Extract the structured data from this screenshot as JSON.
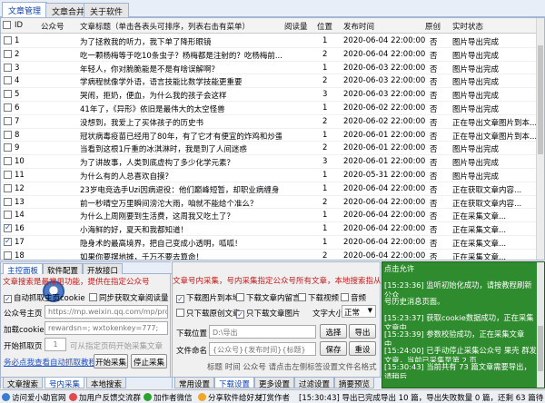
{
  "top_tabs": [
    "文章管理",
    "文章合并",
    "关于软件"
  ],
  "table": {
    "headers": [
      "ID",
      "公众号",
      "文章标题（单击各表头可排序，列表右击有菜单）",
      "阅读量",
      "位置",
      "发布时间",
      "原创",
      "实时状态"
    ],
    "rows": [
      {
        "id": "1",
        "checked": false,
        "title": "为了拯救我的听力，我下单了降形眼镜",
        "pos": "1",
        "time": "2020-06-04 22:00:00",
        "orig": "否",
        "status": "图片导出完成"
      },
      {
        "id": "2",
        "checked": false,
        "title": "吃一颗杨梅等于吃10条虫子？杨梅都是注射的？吃杨梅前...",
        "pos": "2",
        "time": "2020-06-04 22:00:00",
        "orig": "否",
        "status": "图片导出完成"
      },
      {
        "id": "3",
        "checked": false,
        "title": "年轻人，你对脆脆能是不是有啥误解啊？",
        "pos": "1",
        "time": "2020-06-03 22:00:00",
        "orig": "否",
        "status": "图片导出完成"
      },
      {
        "id": "4",
        "checked": false,
        "title": "学病程就像学外语，语言技能比数学技能更重要",
        "pos": "2",
        "time": "2020-06-03 22:00:00",
        "orig": "否",
        "status": "图片导出完成"
      },
      {
        "id": "5",
        "checked": false,
        "title": "哭闹，拒奶，便血，为什么我的孩子会这样",
        "pos": "3",
        "time": "2020-06-03 22:00:00",
        "orig": "否",
        "status": "图片导出完成"
      },
      {
        "id": "6",
        "checked": false,
        "title": "41年了，《异形》依旧是最伟大的太空怪兽",
        "pos": "1",
        "time": "2020-06-02 22:00:00",
        "orig": "否",
        "status": "图片导出完成"
      },
      {
        "id": "7",
        "checked": false,
        "title": "没想到，我爱上了买体孩子的历史书",
        "pos": "2",
        "time": "2020-06-02 22:00:00",
        "orig": "否",
        "status": "正在导出文章图片到本..."
      },
      {
        "id": "8",
        "checked": false,
        "title": "冠状病毒疫苗已经用了80年，有了它才有便宜的炸鸡和炒蛋",
        "pos": "1",
        "time": "2020-06-01 22:00:00",
        "orig": "否",
        "status": "正在导出文章图片到本..."
      },
      {
        "id": "9",
        "checked": false,
        "title": "当看到这根1斤重的冰淇淋时，我是到了人间迷惑",
        "pos": "2",
        "time": "2020-06-01 22:00:00",
        "orig": "否",
        "status": "图片导出完成"
      },
      {
        "id": "10",
        "checked": false,
        "title": "为了讲故事，人类到底虚构了多少化学元素？",
        "pos": "3",
        "time": "2020-06-01 22:00:00",
        "orig": "否",
        "status": "图片导出完成"
      },
      {
        "id": "11",
        "checked": false,
        "title": "为什么有的人总喜欢自摸？",
        "pos": "1",
        "time": "2020-05-31 22:00:00",
        "orig": "否",
        "status": "图片导出完成"
      },
      {
        "id": "12",
        "checked": false,
        "title": "23岁电竞选手Uzi因病退役：他们巅峰短暂，却职业病缠身",
        "pos": "1",
        "time": "2020-06-04 22:00:00",
        "orig": "否",
        "status": "正在获取文章内容..."
      },
      {
        "id": "13",
        "checked": false,
        "title": "前一秒晴空万里瞬间滂沱大雨，咱就不能给个准么？",
        "pos": "2",
        "time": "2020-06-04 22:00:00",
        "orig": "否",
        "status": "正在获取文章内容..."
      },
      {
        "id": "14",
        "checked": false,
        "title": "为什么上周刚要到生活费，这周我又吃土了？",
        "pos": "1",
        "time": "2020-06-04 22:00:00",
        "orig": "否",
        "status": "正在采集文章..."
      },
      {
        "id": "16",
        "checked": true,
        "title": "小海鲜的好，夏天和我都知道！",
        "pos": "1",
        "time": "2020-06-04 22:00:00",
        "orig": "否",
        "status": "正在采集文章..."
      },
      {
        "id": "17",
        "checked": true,
        "title": "隐身术的最高境界，把自己变成小透明，呱呱！",
        "pos": "1",
        "time": "2020-06-04 22:00:00",
        "orig": "否",
        "status": "正在采集文章..."
      },
      {
        "id": "18",
        "checked": false,
        "title": "如果你要摆地摊，千万不要去算命！",
        "pos": "2",
        "time": "2020-06-04 22:00:00",
        "orig": "否",
        "status": "正在采集文章..."
      },
      {
        "id": "19",
        "checked": true,
        "title": "是不是从没有人告诉过你，论文被拒了怎么办？",
        "pos": "1",
        "time": "2020-06-04 22:00:00",
        "orig": "否",
        "status": "正在采集文章..."
      }
    ]
  },
  "left": {
    "tabs": [
      "主控面板",
      "软件配置",
      "开放接口"
    ],
    "tip": "文章搜索是最常用功能，提供在指定公众号",
    "auto_label": "自动抓取主页cookie",
    "sync_label": "同步获取文章阅读量",
    "home_label": "公众号主页",
    "home_value": "https://mp.weixin.qq.com/mp/prc",
    "cookie_label": "加载cookie",
    "cookie_value": "rewardsn=; wxtokenkey=777;",
    "page_label": "开始抓取页",
    "page_value": "1",
    "page_hint": "可从指定页码开始采集文章",
    "link_text": "务必点我查看自动抓取教程",
    "start_button": "开始采集",
    "stop_button": "停止采集",
    "bottom_tabs": [
      "文章搜索",
      "号内采集",
      "本地搜索"
    ]
  },
  "marquee": "文章号内采集，号内采集指定公众号所有文章，本地搜索指从历史搜索文章中快速筛选",
  "middle": {
    "options": [
      "下载图片到本地",
      "下载文章内留言",
      "下载视频",
      "音频",
      "只下载原创文章",
      "只下载文章图片"
    ],
    "checked": [
      true,
      false,
      false,
      false,
      false,
      true
    ],
    "size_label": "文字大小",
    "size_value": "正常",
    "path_label": "下载位置",
    "path_value": "D:\\导出",
    "select_button": "选择",
    "export_button": "导出",
    "name_label": "文件命名",
    "name_value": "{公众号}{发布时间}{标题}",
    "save_button": "保存",
    "reset_button": "重设",
    "hint": "标题  时间  公众号  请点击左侧标签设置文件名格式",
    "bottom_tabs": [
      "常用设置",
      "下载设置",
      "更多设置",
      "过滤设置",
      "摘要预览"
    ]
  },
  "log": [
    "点击允许",
    "[15:23:36] 监听初始化成功，请按教程刷新公众",
    "号历史消息页面。",
    "[15:23:37] 获取cookie数据成功，正在采集文章中...",
    "[15:23:39] 参数校验成功，正在采集文章中...",
    "[15:24:00] 已手动停止采集公众号 果壳 群发文章，当前已采集至第 2 页",
    "[15:30:43] 当前共有 73 篇文章需要导出，请稍后..."
  ],
  "status": {
    "items": [
      "访问爱小助官网",
      "加用户反馈交流群",
      "加作者微信",
      "分享软件给好友",
      "打赏作者"
    ],
    "message": "[15:30:43] 导出已完成导出 10 篇，导出失败数量 0 篇，还剩 63 篇待导出"
  },
  "colors": {
    "accent": "#0a3fb0",
    "log_bg": "#2e8b2e",
    "tip": "#c41b1b"
  }
}
